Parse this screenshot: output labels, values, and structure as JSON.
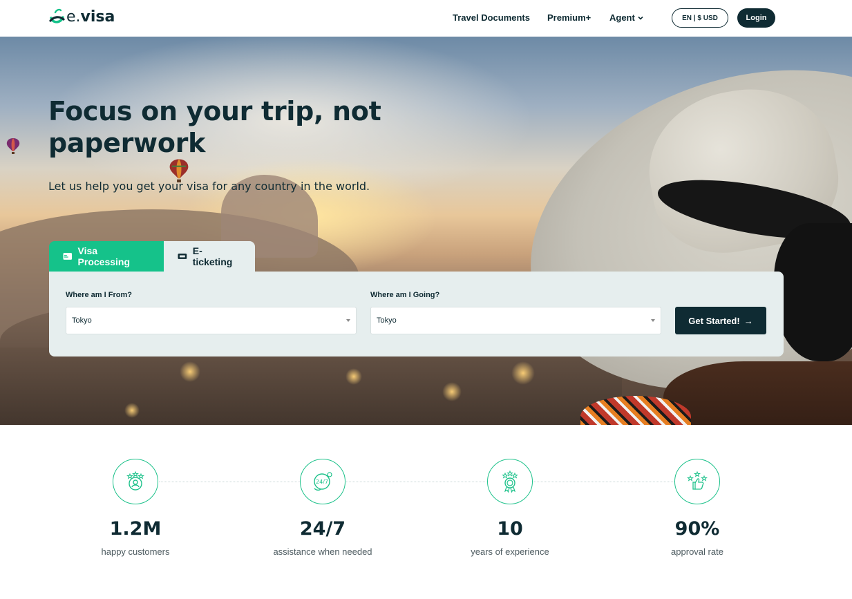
{
  "header": {
    "logo_text_prefix": "e.",
    "logo_text_main": "visa",
    "nav": {
      "travel_documents": "Travel Documents",
      "premium": "Premium+",
      "agent": "Agent"
    },
    "lang_currency": "EN | $ USD",
    "login": "Login"
  },
  "hero": {
    "title": "Focus on your trip, not paperwork",
    "subtitle": "Let us help you get your visa for any country in the world."
  },
  "tabs": [
    {
      "label": "Visa Processing",
      "active": true,
      "icon": "id-card-icon"
    },
    {
      "label": "E-ticketing",
      "active": false,
      "icon": "ticket-icon"
    }
  ],
  "search": {
    "from_label": "Where am I From?",
    "from_value": "Tokyo",
    "to_label": "Where am I Going?",
    "to_value": "Tokyo",
    "submit_label": "Get Started!",
    "submit_arrow": "→"
  },
  "stats": [
    {
      "value": "1.2M",
      "label": "happy customers",
      "icon": "customers-stars-icon"
    },
    {
      "value": "24/7",
      "label": "assistance when needed",
      "icon": "support-24-7-icon"
    },
    {
      "value": "10",
      "label": "years of experience",
      "icon": "award-medal-icon"
    },
    {
      "value": "90%",
      "label": "approval rate",
      "icon": "thumbs-up-stars-icon"
    }
  ],
  "colors": {
    "primary_dark": "#0f2b33",
    "accent_green": "#15c28a",
    "panel_bg": "#e6eeee"
  }
}
